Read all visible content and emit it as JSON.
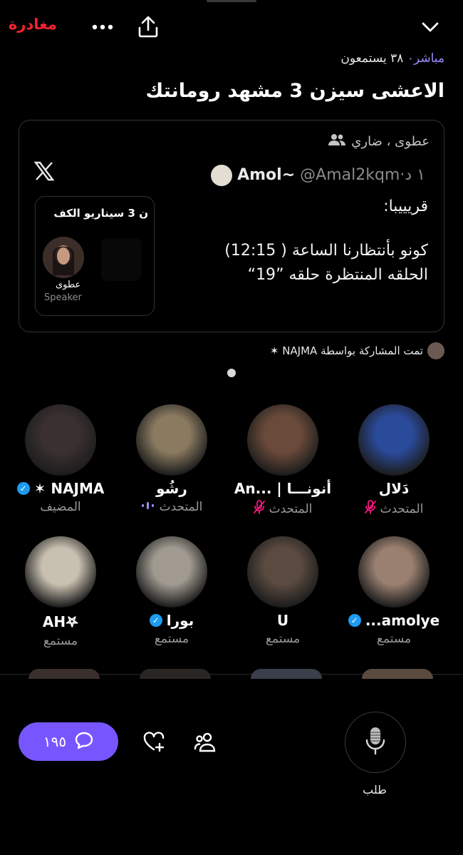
{
  "header": {
    "leave_label": "مغادرة",
    "more_icon": "more-dots-icon",
    "share_icon": "share-icon",
    "collapse_icon": "chevron-down-icon"
  },
  "space": {
    "status_live": "مباشر",
    "listeners": "٣٨ يستمعون",
    "title": "الاعشى  سيزن 3 مشهد رومانتك"
  },
  "pinned_post": {
    "names": "عطوى ، ضاري",
    "author_name": "Amol~",
    "author_handle": "@Amal2kqm",
    "time": "١ د",
    "text_line1": "قريييبا:",
    "text_line2": "كونو بأنتظارنا الساعة ( 12:15)",
    "text_line3": "الحلقه المنتظرة حلقه ”19“",
    "thumb_title": "ن 3 سيناريو الكف",
    "thumb_name": "عطوى",
    "thumb_role": "Speaker"
  },
  "shared_by": "تمت المشاركة بواسطة NAJMA ✶",
  "participants": [
    {
      "name": "دَلال",
      "role": "المتحدث",
      "muted": true,
      "color": "#2a4a9a"
    },
    {
      "name": "أنونـــا | ...An",
      "role": "المتحدث",
      "muted": true,
      "color": "#6a4a3a"
    },
    {
      "name": "رشُو",
      "role": "المتحدث",
      "speaking": true,
      "color": "#8a7a60"
    },
    {
      "name": "NAJMA ✶",
      "role": "المضيف",
      "verified": true,
      "color": "#3a3030"
    },
    {
      "name": "amolye...",
      "role": "مستمع",
      "verified": true,
      "color": "#9a8070"
    },
    {
      "name": "U",
      "role": "مستمع",
      "color": "#5a4a40"
    },
    {
      "name": "بورا",
      "role": "مستمع",
      "verified": true,
      "color": "#a09a90"
    },
    {
      "name": "AH𖤐",
      "role": "مستمع",
      "color": "#c8c0b0"
    }
  ],
  "footer": {
    "comments_count": "١٩٥",
    "request_label": "طلب"
  },
  "colors": {
    "accent": "#7856ff",
    "leave": "#f4212e",
    "live": "#9d8dff",
    "verified": "#1d9bf0",
    "muted": "#f91880"
  }
}
